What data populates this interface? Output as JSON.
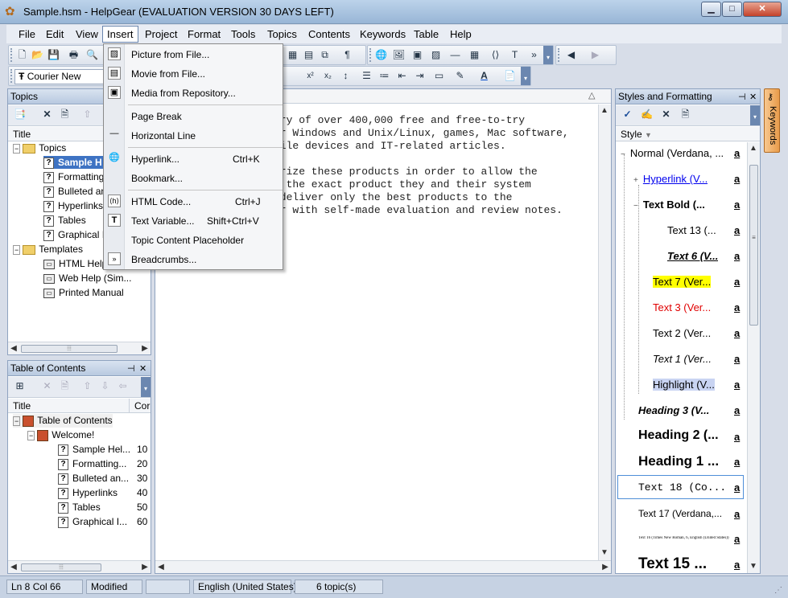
{
  "window": {
    "title": "Sample.hsm - HelpGear (EVALUATION VERSION 30 DAYS LEFT)",
    "minimize": "▁",
    "maximize": "□",
    "close": "✕"
  },
  "menubar": {
    "items": [
      "File",
      "Edit",
      "View",
      "Insert",
      "Project",
      "Format",
      "Tools",
      "Topics",
      "Contents",
      "Keywords",
      "Table",
      "Help"
    ]
  },
  "toolbar": {
    "font_name": "Courier New",
    "paragraph_mark": "¶",
    "superscript": "x²",
    "subscript": "x₂"
  },
  "insert_menu": {
    "items": [
      {
        "label": "Picture from File...",
        "shortcut": ""
      },
      {
        "label": "Movie from File...",
        "shortcut": ""
      },
      {
        "label": "Media from Repository...",
        "shortcut": ""
      },
      {
        "label": "Page Break",
        "shortcut": ""
      },
      {
        "label": "Horizontal Line",
        "shortcut": ""
      },
      {
        "label": "Hyperlink...",
        "shortcut": "Ctrl+K"
      },
      {
        "label": "Bookmark...",
        "shortcut": ""
      },
      {
        "label": "HTML Code...",
        "shortcut": "Ctrl+J"
      },
      {
        "label": "Text Variable...",
        "shortcut": "Shift+Ctrl+V"
      },
      {
        "label": "Topic Content Placeholder",
        "shortcut": ""
      },
      {
        "label": "Breadcrumbs...",
        "shortcut": ""
      }
    ]
  },
  "topics_panel": {
    "title": "Topics",
    "column": "Title",
    "items": [
      {
        "label": "Topics"
      },
      {
        "label": "Sample H"
      },
      {
        "label": "Formatting"
      },
      {
        "label": "Bulleted an"
      },
      {
        "label": "Hyperlinks"
      },
      {
        "label": "Tables"
      },
      {
        "label": "Graphical Ir"
      },
      {
        "label": "Templates"
      },
      {
        "label": "HTML Help"
      },
      {
        "label": "Web Help (Sim..."
      },
      {
        "label": "Printed Manual"
      }
    ]
  },
  "toc_panel": {
    "title": "Table of Contents",
    "col_title": "Title",
    "col_num": "Cor",
    "items": [
      {
        "label": "Table of Contents",
        "num": ""
      },
      {
        "label": "Welcome!",
        "num": ""
      },
      {
        "label": "Sample Hel...",
        "num": "10"
      },
      {
        "label": "Formatting...",
        "num": "20"
      },
      {
        "label": "Bulleted an...",
        "num": "30"
      },
      {
        "label": "Hyperlinks",
        "num": "40"
      },
      {
        "label": "Tables",
        "num": "50"
      },
      {
        "label": "Graphical I...",
        "num": "60"
      }
    ]
  },
  "editor": {
    "lines": [
      "ary of over 400,000 free and free-to-try",
      "or Windows and Unix/Linux, games, Mac software,",
      "bile devices and IT-related articles.",
      "",
      "orize these products in order to allow the",
      "d the exact product they and their system",
      " deliver only the best products to the",
      "er with self-made evaluation and review notes."
    ]
  },
  "styles_panel": {
    "title": "Styles and Formatting",
    "column": "Style",
    "a_glyph": "a",
    "items": [
      {
        "label": "Normal (Verdana, ...",
        "color": "#000000"
      },
      {
        "label": "Hyperlink (V...",
        "color": "#0000ee"
      },
      {
        "label": "Text Bold (...",
        "color": "#000000"
      },
      {
        "label": "Text 13 (...",
        "color": "#000000"
      },
      {
        "label": "Text 6 (V...",
        "color": "#000000"
      },
      {
        "label": "Text 7 (Ver...",
        "color": "#000000",
        "highlight": "#ffff00"
      },
      {
        "label": "Text 3 (Ver...",
        "color": "#e00000"
      },
      {
        "label": "Text 2 (Ver...",
        "color": "#000000"
      },
      {
        "label": "Text 1 (Ver...",
        "color": "#000000"
      },
      {
        "label": "Highlight (V...",
        "color": "#000000",
        "highlight": "#c9d4f2"
      },
      {
        "label": "Heading 3 (V...",
        "color": "#000000"
      },
      {
        "label": "Heading 2 (...",
        "color": "#000000"
      },
      {
        "label": "Heading 1 ...",
        "color": "#000000"
      },
      {
        "label": "Text 18 (Co...",
        "color": "#000000"
      },
      {
        "label": "Text 17 (Verdana,...",
        "color": "#000000"
      },
      {
        "label": "Text 16 (Times New Roman, 6, English (United States))",
        "color": "#000000"
      },
      {
        "label": "Text 15 ...",
        "color": "#000000"
      }
    ]
  },
  "keywords_tab": {
    "label": "Keywords"
  },
  "statusbar": {
    "position": "Ln 8 Col 66",
    "state": "Modified",
    "language": "English (United States)",
    "topics": "6 topic(s)"
  }
}
